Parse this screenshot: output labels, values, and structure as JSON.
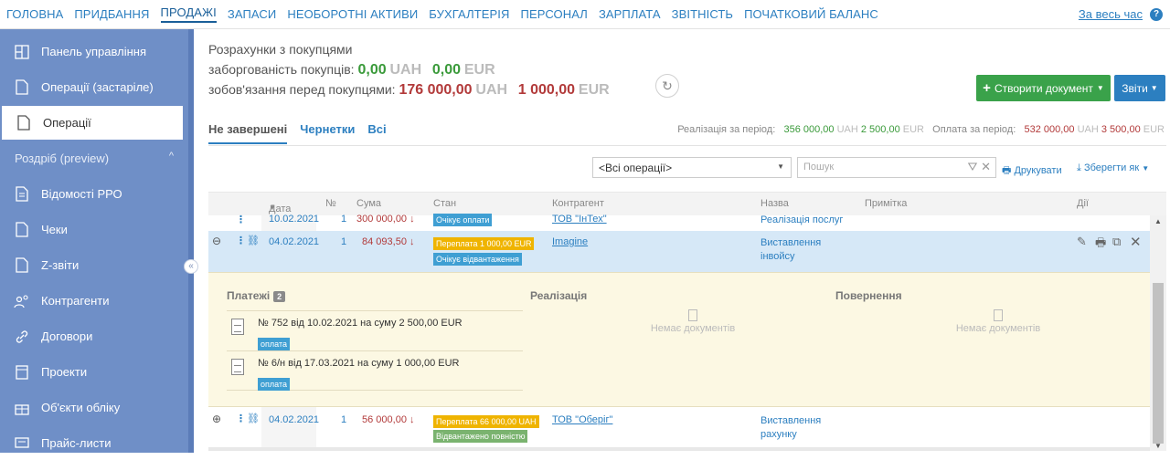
{
  "topnav": {
    "items": [
      "ГОЛОВНА",
      "ПРИДБАННЯ",
      "ПРОДАЖІ",
      "ЗАПАСИ",
      "НЕОБОРОТНІ АКТИВИ",
      "БУХГАЛТЕРІЯ",
      "ПЕРСОНАЛ",
      "ЗАРПЛАТА",
      "ЗВІТНІСТЬ",
      "ПОЧАТКОВИЙ БАЛАНС"
    ],
    "active": "ПРОДАЖІ",
    "period": "За весь час",
    "help": "?"
  },
  "sidebar": {
    "items": [
      {
        "label": "Панель управління",
        "icon": "dashboard-icon"
      },
      {
        "label": "Операції (застаріле)",
        "icon": "document-icon"
      },
      {
        "label": "Операції",
        "icon": "document-icon",
        "active": true
      },
      {
        "label": "Роздріб (preview)",
        "section": true
      },
      {
        "label": "Відомості РРО",
        "icon": "list-document-icon"
      },
      {
        "label": "Чеки",
        "icon": "document-icon"
      },
      {
        "label": "Z-звіти",
        "icon": "document-icon"
      },
      {
        "label": "Контрагенти",
        "icon": "users-icon"
      },
      {
        "label": "Договори",
        "icon": "link-icon"
      },
      {
        "label": "Проекти",
        "icon": "folder-icon"
      },
      {
        "label": "Об'єкти обліку",
        "icon": "gift-icon"
      },
      {
        "label": "Прайс-листи",
        "icon": "chat-icon"
      }
    ],
    "collapse": "«"
  },
  "summary": {
    "title": "Розрахунки з покупцями",
    "debt_label": "заборгованість покупців:",
    "debt_uah": "0,00",
    "debt_uah_cur": "UAH",
    "debt_eur": "0,00",
    "debt_eur_cur": "EUR",
    "oblig_label": "зобов'язання перед покупцями:",
    "oblig_uah": "176 000,00",
    "oblig_uah_cur": "UAH",
    "oblig_eur": "1 000,00",
    "oblig_eur_cur": "EUR"
  },
  "buttons": {
    "create": "Створити документ",
    "reports": "Звіти"
  },
  "tabs": [
    "Не завершені",
    "Чернетки",
    "Всі"
  ],
  "period_stats": {
    "sales_label": "Реалізація за період:",
    "sales_uah": "356 000,00",
    "sales_uah_cur": "UAH",
    "sales_eur": "2 500,00",
    "sales_eur_cur": "EUR",
    "pay_label": "Оплата за період:",
    "pay_uah": "532 000,00",
    "pay_uah_cur": "UAH",
    "pay_eur": "3 500,00",
    "pay_eur_cur": "EUR"
  },
  "filters": {
    "operations": "<Всі операції>",
    "search_placeholder": "Пошук",
    "print": "Друкувати",
    "save_as": "Зберегти як"
  },
  "columns": [
    "Дата",
    "№",
    "Сума",
    "Стан",
    "Контрагент",
    "Назва",
    "Примітка",
    "Дії"
  ],
  "rows": [
    {
      "date": "10.02.2021",
      "num": "1",
      "sum": "300 000,00",
      "badges": [
        "Очікує оплати"
      ],
      "counterparty": "ТОВ \"ІнТех\"",
      "name": "Реалізація послуг"
    },
    {
      "date": "04.02.2021",
      "num": "1",
      "sum": "84 093,50",
      "badges": [
        "Переплата 1 000,00 EUR",
        "Очікує відвантаження"
      ],
      "counterparty": "Imagine",
      "name_line1": "Виставлення",
      "name_line2": "інвойсу"
    },
    {
      "date": "04.02.2021",
      "num": "1",
      "sum": "56 000,00",
      "badges": [
        "Переплата 66 000,00 UAH",
        "Відвантажено повністю"
      ],
      "counterparty": "ТОВ \"Оберіг\"",
      "name_line1": "Виставлення",
      "name_line2": "рахунку"
    }
  ],
  "detail": {
    "payments_label": "Платежі",
    "payments_count": "2",
    "sales_label": "Реалізація",
    "returns_label": "Повернення",
    "payments": [
      {
        "text": "№ 752 від 10.02.2021 на суму 2 500,00 EUR",
        "badge": "оплата"
      },
      {
        "text": "№ 6/н від 17.03.2021 на суму 1 000,00 EUR",
        "badge": "оплата"
      }
    ],
    "empty": "Немає документів"
  }
}
